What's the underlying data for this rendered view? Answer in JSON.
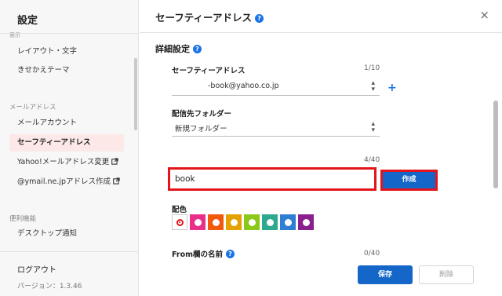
{
  "sidebar": {
    "title": "設定",
    "cut_label": "表示",
    "items": [
      {
        "label": "レイアウト・文字"
      },
      {
        "label": "きせかえテーマ"
      },
      {
        "label": "メールアカウント"
      },
      {
        "label": "セーフティーアドレス"
      },
      {
        "label": "Yahoo!メールアドレス変更"
      },
      {
        "label": "@ymail.ne.jpアドレス作成"
      },
      {
        "label": "デスクトップ通知"
      }
    ],
    "section_mail": "メールアドレス",
    "section_convenience": "便利機能",
    "logout": "ログアウト",
    "version": "バージョン：1.3.46"
  },
  "header": {
    "title": "セーフティーアドレス",
    "help_icon": "?",
    "close_icon": "×"
  },
  "main": {
    "section_title": "詳細設定",
    "safety_address": {
      "label": "セーフティーアドレス",
      "counter": "1/10",
      "value": "-book@yahoo.co.jp",
      "add_icon": "+"
    },
    "folder": {
      "label": "配信先フォルダー",
      "value": "新規フォルダー"
    },
    "keyword": {
      "counter": "4/40",
      "value": "book",
      "create_label": "作成"
    },
    "color": {
      "label": "配色",
      "swatches": [
        "#ffffff",
        "#e8308a",
        "#f25a0b",
        "#e5a100",
        "#8bc81a",
        "#2ea88e",
        "#2e7fd4",
        "#8a1f8e"
      ]
    },
    "from_name": {
      "label": "From欄の名前",
      "counter": "0/40"
    },
    "save_label": "保存",
    "delete_label": "削除"
  },
  "colors": {
    "accent": "#1566c9",
    "highlight": "#e5141b",
    "active_bg": "#fde8e8"
  }
}
